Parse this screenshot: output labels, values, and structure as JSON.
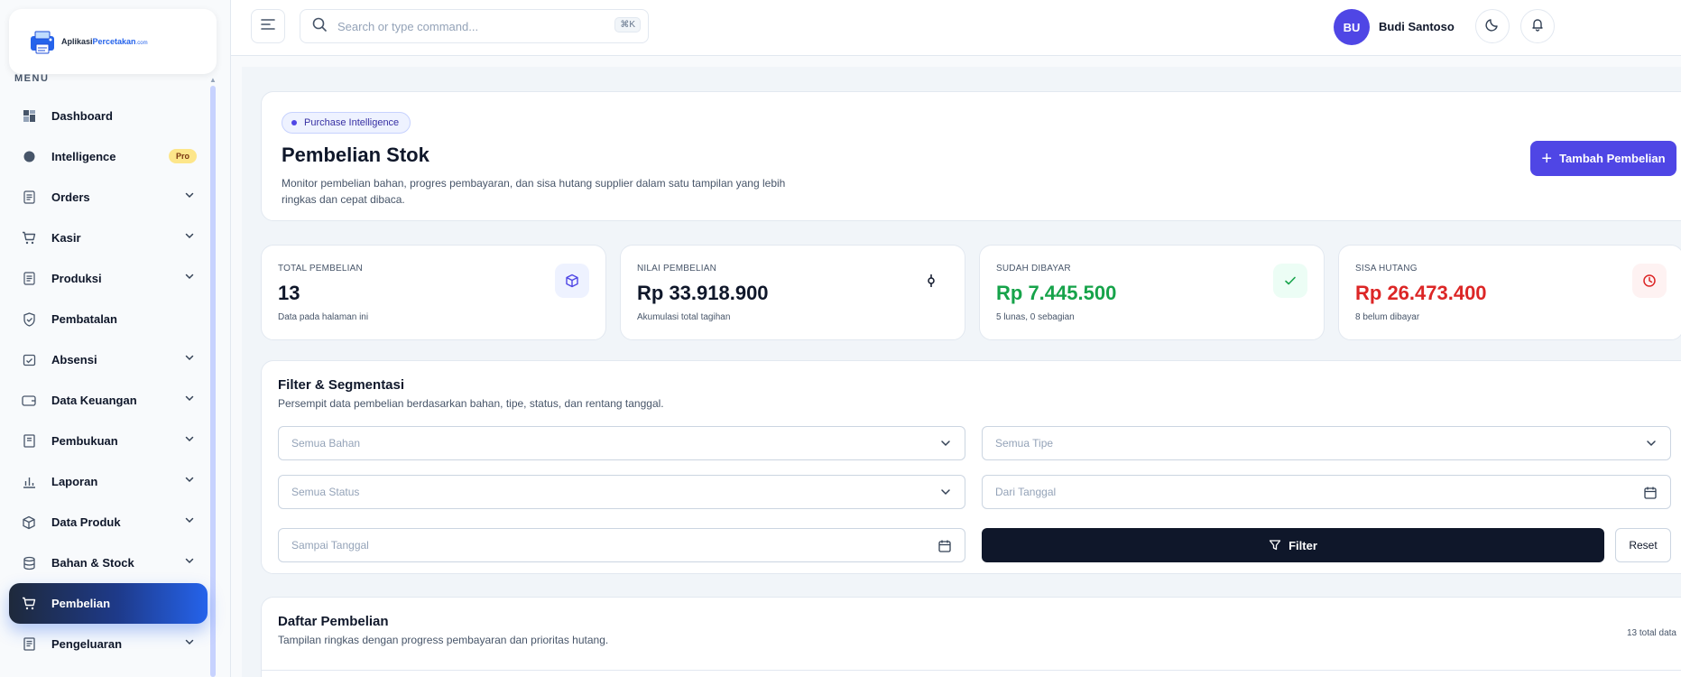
{
  "brand": {
    "prefix": "Aplikasi",
    "accent": "Percetakan",
    "domain": ".com"
  },
  "sidebar": {
    "menu_label": "MENU",
    "items": [
      {
        "label": "Dashboard",
        "icon": "dashboard-icon",
        "chevron": false
      },
      {
        "label": "Intelligence",
        "icon": "brain-icon",
        "chevron": false,
        "badge": "Pro"
      },
      {
        "label": "Orders",
        "icon": "list-icon",
        "chevron": true
      },
      {
        "label": "Kasir",
        "icon": "cart-icon",
        "chevron": true
      },
      {
        "label": "Produksi",
        "icon": "list-icon",
        "chevron": true
      },
      {
        "label": "Pembatalan",
        "icon": "shield-icon",
        "chevron": false
      },
      {
        "label": "Absensi",
        "icon": "calendar-check-icon",
        "chevron": true
      },
      {
        "label": "Data Keuangan",
        "icon": "wallet-icon",
        "chevron": true
      },
      {
        "label": "Pembukuan",
        "icon": "book-icon",
        "chevron": true
      },
      {
        "label": "Laporan",
        "icon": "bar-chart-icon",
        "chevron": true
      },
      {
        "label": "Data Produk",
        "icon": "box-icon",
        "chevron": true
      },
      {
        "label": "Bahan & Stock",
        "icon": "database-icon",
        "chevron": true
      },
      {
        "label": "Pembelian",
        "icon": "cart-icon",
        "chevron": false,
        "active": true
      },
      {
        "label": "Pengeluaran",
        "icon": "receipt-icon",
        "chevron": true
      }
    ]
  },
  "topbar": {
    "search_placeholder": "Search or type command...",
    "shortcut": "⌘K",
    "user_initials": "BU",
    "user_name": "Budi Santoso"
  },
  "hero": {
    "pill": "Purchase Intelligence",
    "title": "Pembelian Stok",
    "description": "Monitor pembelian bahan, progres pembayaran, dan sisa hutang supplier dalam satu tampilan yang lebih ringkas dan cepat dibaca.",
    "add_button": "Tambah Pembelian"
  },
  "stats": [
    {
      "label": "TOTAL PEMBELIAN",
      "value": "13",
      "sub": "Data pada halaman ini",
      "value_color": "#0f172a",
      "icon": "cube-icon"
    },
    {
      "label": "NILAI PEMBELIAN",
      "value": "Rp 33.918.900",
      "sub": "Akumulasi total tagihan",
      "value_color": "#0f172a",
      "icon": "commit-icon"
    },
    {
      "label": "SUDAH DIBAYAR",
      "value": "Rp 7.445.500",
      "sub": "5 lunas, 0 sebagian",
      "value_color": "#16a34a",
      "icon": "check-icon"
    },
    {
      "label": "SISA HUTANG",
      "value": "Rp 26.473.400",
      "sub": "8 belum dibayar",
      "value_color": "#dc2626",
      "icon": "clock-icon"
    }
  ],
  "filter": {
    "title": "Filter & Segmentasi",
    "description": "Persempit data pembelian berdasarkan bahan, tipe, status, dan rentang tanggal.",
    "bahan": "Semua Bahan",
    "tipe": "Semua Tipe",
    "status": "Semua Status",
    "dari": "Dari Tanggal",
    "sampai": "Sampai Tanggal",
    "filter_button": "Filter",
    "reset_button": "Reset"
  },
  "list": {
    "title": "Daftar Pembelian",
    "description": "Tampilan ringkas dengan progress pembayaran dan prioritas hutang.",
    "count": "13 total data"
  }
}
